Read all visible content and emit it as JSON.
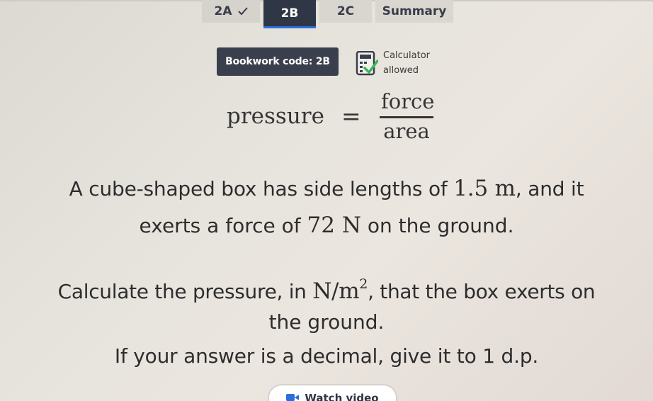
{
  "tabs": [
    {
      "label": "2A",
      "completed": true,
      "active": false
    },
    {
      "label": "2B",
      "completed": false,
      "active": true
    },
    {
      "label": "2C",
      "completed": false,
      "active": false
    },
    {
      "label": "Summary",
      "completed": false,
      "active": false
    }
  ],
  "bookwork": {
    "label": "Bookwork code: 2B"
  },
  "calculator": {
    "line1": "Calculator",
    "line2": "allowed",
    "icon": "calculator-check-icon"
  },
  "formula": {
    "lhs": "pressure",
    "eq": "=",
    "numerator": "force",
    "denominator": "area"
  },
  "question": {
    "line1_a": "A cube-shaped box has side lengths of ",
    "line1_m": "1.5 m",
    "line1_b": ", and it",
    "line2_a": "exerts a force of ",
    "line2_m": "72 N",
    "line2_b": " on the ground.",
    "line3_a": "Calculate the pressure, in ",
    "line3_m": "N/m",
    "line3_sup": "2",
    "line3_b": ", that the box exerts on",
    "line4": "the ground.",
    "line5": "If your answer is a decimal, give it to 1 d.p."
  },
  "watch_video": {
    "label": "Watch video",
    "icon": "video-icon"
  },
  "colors": {
    "tab_active_bg": "#2f3645",
    "tab_active_underline": "#2a6fdb",
    "bookwork_bg": "#3a3f4d",
    "calc_check": "#3db35a"
  }
}
